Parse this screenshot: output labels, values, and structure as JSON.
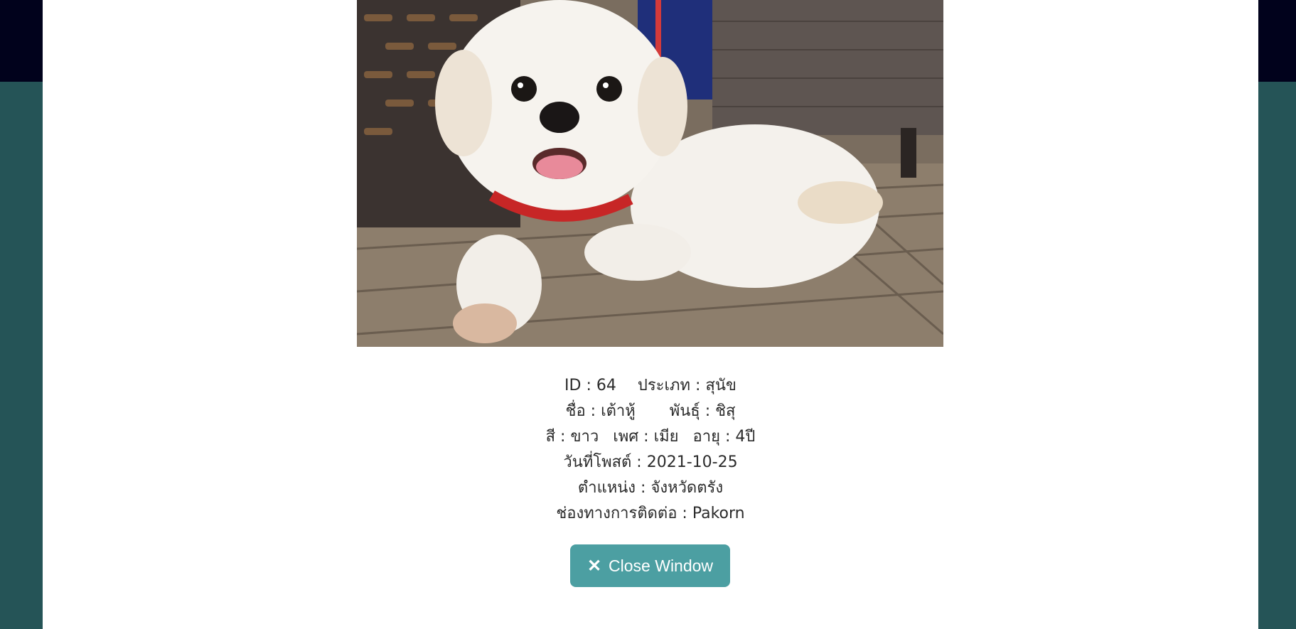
{
  "pet": {
    "id_label": "ID :",
    "id_value": "64",
    "type_label": "ประเภท :",
    "type_value": "สุนัข",
    "name_label": "ชื่อ :",
    "name_value": "เต้าหู้",
    "breed_label": "พันธุ์ :",
    "breed_value": "ชิสุ",
    "color_label": "สี :",
    "color_value": "ขาว",
    "sex_label": "เพศ :",
    "sex_value": "เมีย",
    "age_label": "อายุ :",
    "age_value": "4ปี",
    "post_date_label": "วันที่โพสต์ :",
    "post_date_value": "2021-10-25",
    "location_label": "ตำแหน่ง :",
    "location_value": "จังหวัดตรัง",
    "contact_label": "ช่องทางการติดต่อ :",
    "contact_value": "Pakorn"
  },
  "actions": {
    "close_label": "Close Window",
    "close_icon": "x-icon"
  },
  "colors": {
    "top_band": "#01021c",
    "page_background": "#255457",
    "modal_background": "#ffffff",
    "button_background": "#4c9fa2"
  }
}
